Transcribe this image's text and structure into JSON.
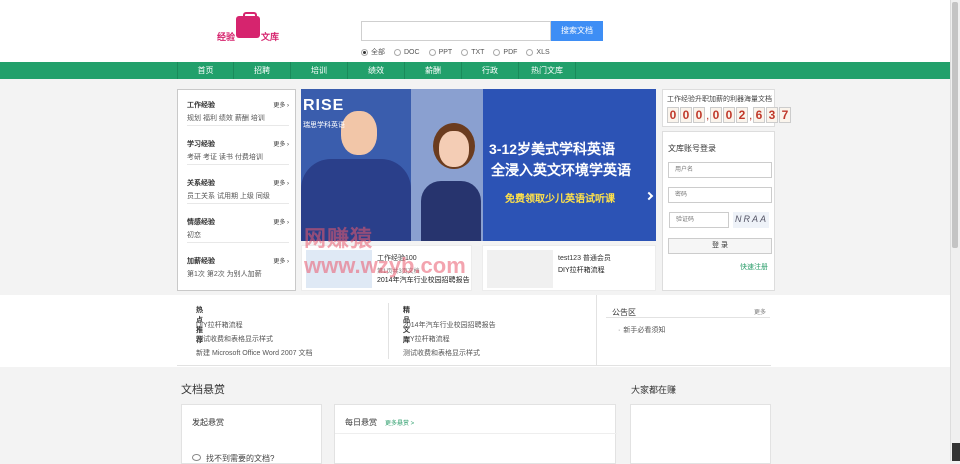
{
  "logo": {
    "left": "经验",
    "right": "文库"
  },
  "search": {
    "placeholder": "",
    "button": "搜索文档"
  },
  "filters": [
    "全部",
    "DOC",
    "PPT",
    "TXT",
    "PDF",
    "XLS"
  ],
  "nav": [
    "首页",
    "招聘",
    "培训",
    "绩效",
    "薪酬",
    "行政",
    "热门文库"
  ],
  "categories": [
    {
      "title": "工作经验",
      "more": "更多 ›",
      "links": "规划  福利  绩效  薪酬  培训"
    },
    {
      "title": "学习经验",
      "more": "更多 ›",
      "links": "考研  考证  读书  付费培训"
    },
    {
      "title": "关系经验",
      "more": "更多 ›",
      "links": "员工关系  试用期  上级  同级"
    },
    {
      "title": "情感经验",
      "more": "更多 ›",
      "links": "初恋"
    },
    {
      "title": "加薪经验",
      "more": "更多 ›",
      "links": "第1次  第2次  为别人加薪"
    }
  ],
  "banner": {
    "brand": "RISE",
    "brand_sub": "瑞思学科英语",
    "line1": "3-12岁美式学科英语",
    "line2": "全浸入英文环境学英语",
    "cta": "免费领取少儿英语试听课"
  },
  "docs": [
    {
      "title": "工作经验100",
      "sub": "第1页共3页文档",
      "desc": "2014年汽车行业校园招聘报告"
    },
    {
      "title": "test123   普通会员",
      "sub": "",
      "desc": "DIY拉杆箱流程"
    }
  ],
  "counter": {
    "caption": "工作经验升职加薪的利器海量文档",
    "digits": [
      "0",
      "0",
      "0",
      ",",
      "0",
      "0",
      "2",
      ",",
      "6",
      "3",
      "7"
    ]
  },
  "login": {
    "title": "文库账号登录",
    "user_placeholder": "用户名",
    "pass_placeholder": "密码",
    "captcha_placeholder": "验证码",
    "captcha_text": "NRAA",
    "button": "登 录",
    "register": "快速注册"
  },
  "hot": {
    "title": "热点推荐",
    "items": [
      "DIY拉杆箱流程",
      "测试收费和表格显示样式",
      "新建 Microsoft Office Word 2007 文档"
    ]
  },
  "fine": {
    "title": "精品文库",
    "items": [
      "2014年汽车行业校园招聘报告",
      "DIY拉杆箱流程",
      "测试收费和表格显示样式"
    ]
  },
  "notice": {
    "title": "公告区",
    "more": "更多",
    "items": [
      "新手必看须知"
    ]
  },
  "reward": {
    "title": "文档悬赏",
    "earn": "大家都在赚",
    "box1": "发起悬赏",
    "box1_q": "找不到需要的文档?",
    "box2": "每日悬赏",
    "box2_more": "更多悬赏 >"
  },
  "watermark": {
    "line1": "网赚猿",
    "line2": "www.wzyb.com"
  }
}
